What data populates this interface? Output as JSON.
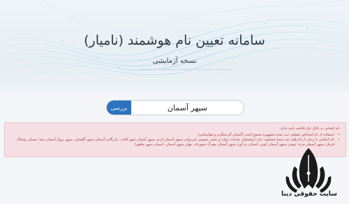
{
  "header": {
    "title": "سامانه تعیین نام هوشمند (نامیار)",
    "subtitle": "نسخه آزمایشی"
  },
  "search": {
    "value": "سپهر آسمان",
    "button_label": "بررسی"
  },
  "alert": {
    "heading": "نام انتخابی به دلایل ذیل قابلیت تایید ندارد:",
    "items": [
      "استفاده از نام اشخاص حقوقی ثبت شده مشهوره ممنوع است (آسمان گردشگری و هواپیمایی)",
      "نام انتخابی با برخی از نام های ثبت شده مشابهت دارد (پیشخوان خدمات دولت و بخش عمومی غیردولتی سپهر آسمان ایرم، سپهر آسمان شهر آفتاب، بازرگانی آسمان سپهر گلستان، سپهر پرواز آسمان رسا، مسکن پوشاک فرمان سپهر آسمان مزند، توسن سپهر آسمان کوین، آسمان ره آورد سپهر آسمان بشرگ سپهرداد، جهان سپهر آسمان، آسمان سپهر ماهور)"
    ]
  },
  "watermark": {
    "text": "سایت حقوقی دینا"
  }
}
